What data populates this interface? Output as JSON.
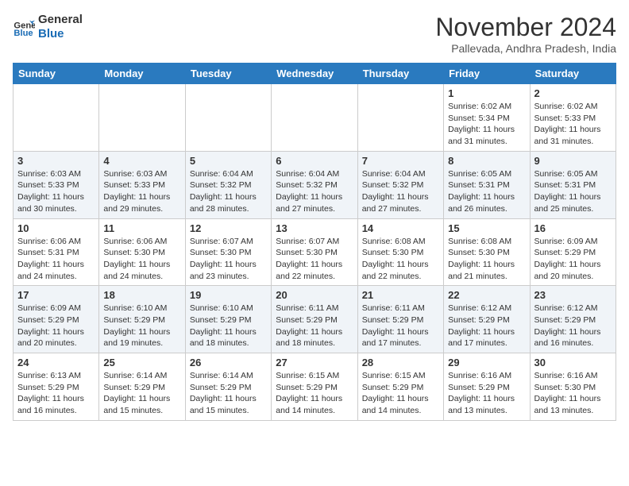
{
  "header": {
    "logo_line1": "General",
    "logo_line2": "Blue",
    "month": "November 2024",
    "location": "Pallevada, Andhra Pradesh, India"
  },
  "weekdays": [
    "Sunday",
    "Monday",
    "Tuesday",
    "Wednesday",
    "Thursday",
    "Friday",
    "Saturday"
  ],
  "weeks": [
    [
      {
        "day": "",
        "text": ""
      },
      {
        "day": "",
        "text": ""
      },
      {
        "day": "",
        "text": ""
      },
      {
        "day": "",
        "text": ""
      },
      {
        "day": "",
        "text": ""
      },
      {
        "day": "1",
        "text": "Sunrise: 6:02 AM\nSunset: 5:34 PM\nDaylight: 11 hours and 31 minutes."
      },
      {
        "day": "2",
        "text": "Sunrise: 6:02 AM\nSunset: 5:33 PM\nDaylight: 11 hours and 31 minutes."
      }
    ],
    [
      {
        "day": "3",
        "text": "Sunrise: 6:03 AM\nSunset: 5:33 PM\nDaylight: 11 hours and 30 minutes."
      },
      {
        "day": "4",
        "text": "Sunrise: 6:03 AM\nSunset: 5:33 PM\nDaylight: 11 hours and 29 minutes."
      },
      {
        "day": "5",
        "text": "Sunrise: 6:04 AM\nSunset: 5:32 PM\nDaylight: 11 hours and 28 minutes."
      },
      {
        "day": "6",
        "text": "Sunrise: 6:04 AM\nSunset: 5:32 PM\nDaylight: 11 hours and 27 minutes."
      },
      {
        "day": "7",
        "text": "Sunrise: 6:04 AM\nSunset: 5:32 PM\nDaylight: 11 hours and 27 minutes."
      },
      {
        "day": "8",
        "text": "Sunrise: 6:05 AM\nSunset: 5:31 PM\nDaylight: 11 hours and 26 minutes."
      },
      {
        "day": "9",
        "text": "Sunrise: 6:05 AM\nSunset: 5:31 PM\nDaylight: 11 hours and 25 minutes."
      }
    ],
    [
      {
        "day": "10",
        "text": "Sunrise: 6:06 AM\nSunset: 5:31 PM\nDaylight: 11 hours and 24 minutes."
      },
      {
        "day": "11",
        "text": "Sunrise: 6:06 AM\nSunset: 5:30 PM\nDaylight: 11 hours and 24 minutes."
      },
      {
        "day": "12",
        "text": "Sunrise: 6:07 AM\nSunset: 5:30 PM\nDaylight: 11 hours and 23 minutes."
      },
      {
        "day": "13",
        "text": "Sunrise: 6:07 AM\nSunset: 5:30 PM\nDaylight: 11 hours and 22 minutes."
      },
      {
        "day": "14",
        "text": "Sunrise: 6:08 AM\nSunset: 5:30 PM\nDaylight: 11 hours and 22 minutes."
      },
      {
        "day": "15",
        "text": "Sunrise: 6:08 AM\nSunset: 5:30 PM\nDaylight: 11 hours and 21 minutes."
      },
      {
        "day": "16",
        "text": "Sunrise: 6:09 AM\nSunset: 5:29 PM\nDaylight: 11 hours and 20 minutes."
      }
    ],
    [
      {
        "day": "17",
        "text": "Sunrise: 6:09 AM\nSunset: 5:29 PM\nDaylight: 11 hours and 20 minutes."
      },
      {
        "day": "18",
        "text": "Sunrise: 6:10 AM\nSunset: 5:29 PM\nDaylight: 11 hours and 19 minutes."
      },
      {
        "day": "19",
        "text": "Sunrise: 6:10 AM\nSunset: 5:29 PM\nDaylight: 11 hours and 18 minutes."
      },
      {
        "day": "20",
        "text": "Sunrise: 6:11 AM\nSunset: 5:29 PM\nDaylight: 11 hours and 18 minutes."
      },
      {
        "day": "21",
        "text": "Sunrise: 6:11 AM\nSunset: 5:29 PM\nDaylight: 11 hours and 17 minutes."
      },
      {
        "day": "22",
        "text": "Sunrise: 6:12 AM\nSunset: 5:29 PM\nDaylight: 11 hours and 17 minutes."
      },
      {
        "day": "23",
        "text": "Sunrise: 6:12 AM\nSunset: 5:29 PM\nDaylight: 11 hours and 16 minutes."
      }
    ],
    [
      {
        "day": "24",
        "text": "Sunrise: 6:13 AM\nSunset: 5:29 PM\nDaylight: 11 hours and 16 minutes."
      },
      {
        "day": "25",
        "text": "Sunrise: 6:14 AM\nSunset: 5:29 PM\nDaylight: 11 hours and 15 minutes."
      },
      {
        "day": "26",
        "text": "Sunrise: 6:14 AM\nSunset: 5:29 PM\nDaylight: 11 hours and 15 minutes."
      },
      {
        "day": "27",
        "text": "Sunrise: 6:15 AM\nSunset: 5:29 PM\nDaylight: 11 hours and 14 minutes."
      },
      {
        "day": "28",
        "text": "Sunrise: 6:15 AM\nSunset: 5:29 PM\nDaylight: 11 hours and 14 minutes."
      },
      {
        "day": "29",
        "text": "Sunrise: 6:16 AM\nSunset: 5:29 PM\nDaylight: 11 hours and 13 minutes."
      },
      {
        "day": "30",
        "text": "Sunrise: 6:16 AM\nSunset: 5:30 PM\nDaylight: 11 hours and 13 minutes."
      }
    ]
  ]
}
